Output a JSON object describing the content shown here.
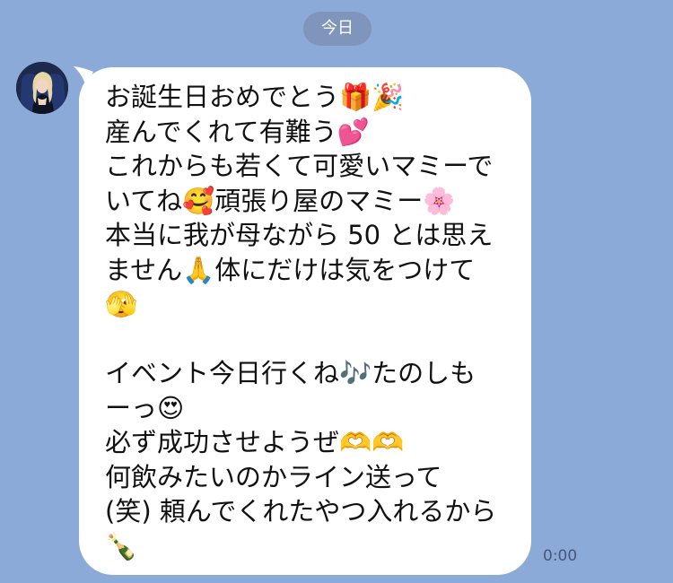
{
  "header": {
    "date_label": "今日"
  },
  "message": {
    "lines": [
      "お誕生日おめでとう🎁🎉",
      "産んでくれて有難う💕",
      "これからも若くて可愛いマミーで",
      "いてね🥰頑張り屋のマミー🌸",
      "本当に我が母ながら 50 とは思え",
      "ません🙏体にだけは気をつけて",
      "🫣",
      "",
      "イベント今日行くね🎶たのしも",
      "ーっ😍",
      "必ず成功させようぜ🫶🫶",
      "何飲みたいのかライン送って",
      "(笑) 頼んでくれたやつ入れるから",
      "🍾"
    ],
    "time": "0:00"
  },
  "colors": {
    "background": "#8caad8",
    "bubble": "#ffffff",
    "text": "#111111",
    "time_text": "#46577a"
  }
}
